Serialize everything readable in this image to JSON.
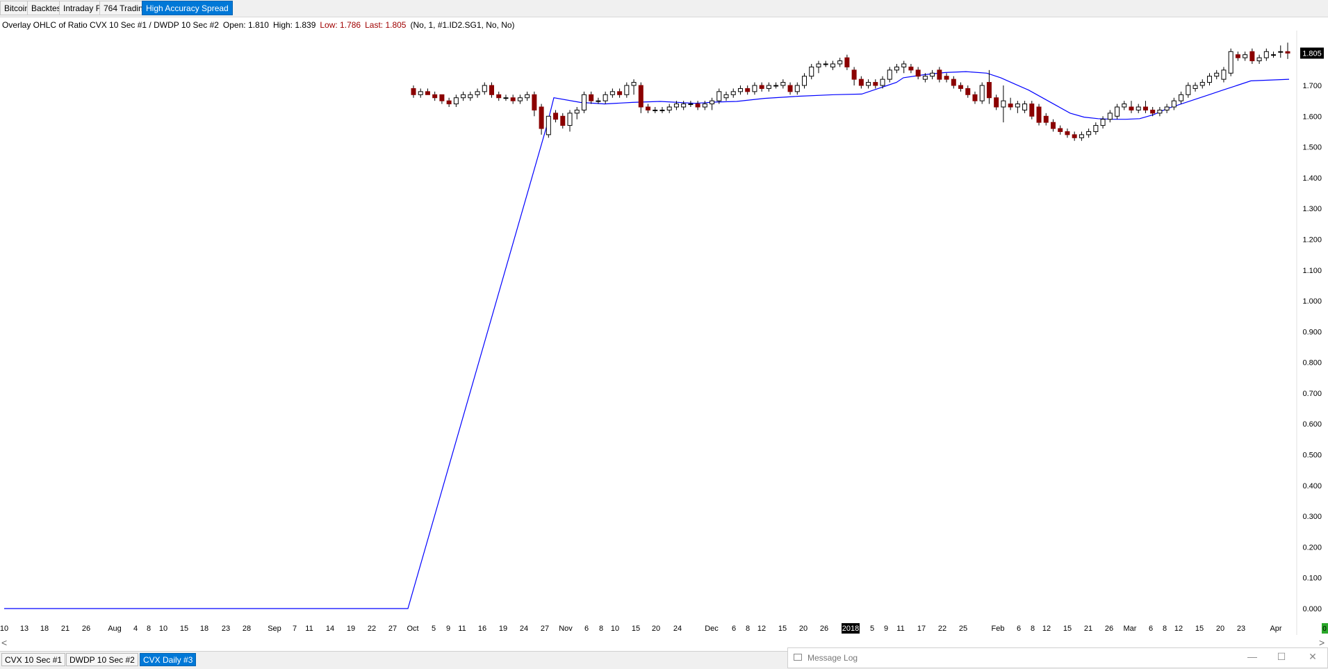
{
  "tabs": [
    "Bitcoin",
    "Backtest",
    "Intraday FX",
    "764 Trading",
    "High Accuracy Spread"
  ],
  "info": {
    "prefix": "Overlay OHLC of Ratio CVX  10 Sec  #1 / DWDP  10 Sec  #2",
    "open": "Open: 1.810",
    "high": "High: 1.839",
    "low": "Low: 1.786",
    "last": "Last: 1.805",
    "params": "(No, 1, #1.ID2.SG1, No, No)"
  },
  "chart_data": {
    "type": "candlestick",
    "y_ticks": [
      "1.805",
      "1.700",
      "1.600",
      "1.500",
      "1.400",
      "1.300",
      "1.200",
      "1.100",
      "1.000",
      "0.900",
      "0.800",
      "0.700",
      "0.600",
      "0.500",
      "0.400",
      "0.300",
      "0.200",
      "0.100",
      "0.000"
    ],
    "current_value": "1.805",
    "x_ticks": [
      "10",
      "13",
      "18",
      "21",
      "26",
      "Aug",
      "4",
      "8",
      "10",
      "15",
      "18",
      "23",
      "28",
      "Sep",
      "7",
      "11",
      "14",
      "19",
      "22",
      "27",
      "Oct",
      "5",
      "9",
      "11",
      "16",
      "19",
      "24",
      "27",
      "Nov",
      "6",
      "8",
      "10",
      "15",
      "20",
      "24",
      "Dec",
      "6",
      "8",
      "12",
      "15",
      "20",
      "26",
      "2018",
      "5",
      "9",
      "11",
      "17",
      "22",
      "25",
      "Feb",
      "6",
      "8",
      "12",
      "15",
      "21",
      "26",
      "Mar",
      "6",
      "8",
      "12",
      "15",
      "20",
      "23",
      "Apr"
    ],
    "ylim": [
      0,
      1.82
    ],
    "candles": [
      [
        1.69,
        1.7,
        1.66,
        1.67
      ],
      [
        1.67,
        1.69,
        1.66,
        1.68
      ],
      [
        1.68,
        1.69,
        1.67,
        1.67
      ],
      [
        1.67,
        1.68,
        1.65,
        1.66
      ],
      [
        1.67,
        1.67,
        1.64,
        1.65
      ],
      [
        1.65,
        1.66,
        1.63,
        1.64
      ],
      [
        1.64,
        1.67,
        1.63,
        1.66
      ],
      [
        1.66,
        1.68,
        1.65,
        1.67
      ],
      [
        1.66,
        1.68,
        1.65,
        1.67
      ],
      [
        1.67,
        1.69,
        1.66,
        1.68
      ],
      [
        1.68,
        1.71,
        1.67,
        1.7
      ],
      [
        1.7,
        1.71,
        1.66,
        1.67
      ],
      [
        1.67,
        1.68,
        1.65,
        1.66
      ],
      [
        1.66,
        1.67,
        1.65,
        1.66
      ],
      [
        1.66,
        1.67,
        1.64,
        1.65
      ],
      [
        1.65,
        1.67,
        1.64,
        1.66
      ],
      [
        1.66,
        1.68,
        1.65,
        1.67
      ],
      [
        1.67,
        1.68,
        1.6,
        1.62
      ],
      [
        1.63,
        1.64,
        1.54,
        1.56
      ],
      [
        1.54,
        1.6,
        1.53,
        1.6
      ],
      [
        1.61,
        1.62,
        1.58,
        1.59
      ],
      [
        1.6,
        1.61,
        1.56,
        1.57
      ],
      [
        1.57,
        1.62,
        1.55,
        1.61
      ],
      [
        1.61,
        1.63,
        1.59,
        1.62
      ],
      [
        1.62,
        1.68,
        1.61,
        1.67
      ],
      [
        1.67,
        1.68,
        1.64,
        1.65
      ],
      [
        1.65,
        1.66,
        1.64,
        1.65
      ],
      [
        1.65,
        1.68,
        1.64,
        1.67
      ],
      [
        1.67,
        1.69,
        1.66,
        1.68
      ],
      [
        1.68,
        1.69,
        1.66,
        1.67
      ],
      [
        1.67,
        1.71,
        1.66,
        1.7
      ],
      [
        1.7,
        1.72,
        1.67,
        1.71
      ],
      [
        1.7,
        1.71,
        1.61,
        1.63
      ],
      [
        1.63,
        1.64,
        1.61,
        1.62
      ],
      [
        1.62,
        1.63,
        1.61,
        1.62
      ],
      [
        1.62,
        1.63,
        1.61,
        1.62
      ],
      [
        1.62,
        1.64,
        1.61,
        1.63
      ],
      [
        1.63,
        1.65,
        1.62,
        1.64
      ],
      [
        1.63,
        1.65,
        1.62,
        1.64
      ],
      [
        1.64,
        1.65,
        1.63,
        1.64
      ],
      [
        1.64,
        1.65,
        1.62,
        1.63
      ],
      [
        1.63,
        1.65,
        1.62,
        1.64
      ],
      [
        1.64,
        1.66,
        1.62,
        1.65
      ],
      [
        1.65,
        1.69,
        1.64,
        1.68
      ],
      [
        1.66,
        1.68,
        1.65,
        1.67
      ],
      [
        1.67,
        1.69,
        1.66,
        1.68
      ],
      [
        1.68,
        1.7,
        1.67,
        1.69
      ],
      [
        1.69,
        1.7,
        1.67,
        1.68
      ],
      [
        1.68,
        1.71,
        1.67,
        1.7
      ],
      [
        1.7,
        1.71,
        1.68,
        1.69
      ],
      [
        1.69,
        1.71,
        1.68,
        1.7
      ],
      [
        1.7,
        1.71,
        1.69,
        1.7
      ],
      [
        1.7,
        1.72,
        1.69,
        1.71
      ],
      [
        1.7,
        1.71,
        1.67,
        1.68
      ],
      [
        1.68,
        1.71,
        1.67,
        1.7
      ],
      [
        1.7,
        1.74,
        1.69,
        1.73
      ],
      [
        1.73,
        1.77,
        1.72,
        1.76
      ],
      [
        1.76,
        1.78,
        1.74,
        1.77
      ],
      [
        1.77,
        1.78,
        1.76,
        1.77
      ],
      [
        1.76,
        1.78,
        1.75,
        1.77
      ],
      [
        1.77,
        1.79,
        1.76,
        1.78
      ],
      [
        1.79,
        1.8,
        1.75,
        1.76
      ],
      [
        1.75,
        1.76,
        1.7,
        1.72
      ],
      [
        1.72,
        1.73,
        1.69,
        1.7
      ],
      [
        1.7,
        1.72,
        1.69,
        1.71
      ],
      [
        1.71,
        1.72,
        1.69,
        1.7
      ],
      [
        1.7,
        1.73,
        1.69,
        1.72
      ],
      [
        1.72,
        1.76,
        1.71,
        1.75
      ],
      [
        1.75,
        1.77,
        1.74,
        1.76
      ],
      [
        1.76,
        1.78,
        1.74,
        1.77
      ],
      [
        1.76,
        1.77,
        1.74,
        1.75
      ],
      [
        1.75,
        1.76,
        1.72,
        1.73
      ],
      [
        1.72,
        1.74,
        1.71,
        1.73
      ],
      [
        1.73,
        1.75,
        1.72,
        1.74
      ],
      [
        1.75,
        1.76,
        1.71,
        1.72
      ],
      [
        1.73,
        1.74,
        1.71,
        1.72
      ],
      [
        1.72,
        1.73,
        1.69,
        1.7
      ],
      [
        1.7,
        1.71,
        1.68,
        1.69
      ],
      [
        1.69,
        1.7,
        1.66,
        1.67
      ],
      [
        1.67,
        1.68,
        1.64,
        1.65
      ],
      [
        1.65,
        1.71,
        1.64,
        1.7
      ],
      [
        1.71,
        1.75,
        1.64,
        1.66
      ],
      [
        1.66,
        1.67,
        1.62,
        1.63
      ],
      [
        1.63,
        1.7,
        1.58,
        1.65
      ],
      [
        1.64,
        1.66,
        1.62,
        1.63
      ],
      [
        1.63,
        1.65,
        1.61,
        1.64
      ],
      [
        1.62,
        1.65,
        1.61,
        1.64
      ],
      [
        1.64,
        1.65,
        1.59,
        1.6
      ],
      [
        1.63,
        1.64,
        1.57,
        1.58
      ],
      [
        1.6,
        1.61,
        1.57,
        1.58
      ],
      [
        1.58,
        1.59,
        1.55,
        1.56
      ],
      [
        1.56,
        1.57,
        1.54,
        1.55
      ],
      [
        1.55,
        1.56,
        1.53,
        1.54
      ],
      [
        1.54,
        1.55,
        1.52,
        1.53
      ],
      [
        1.53,
        1.55,
        1.52,
        1.54
      ],
      [
        1.54,
        1.56,
        1.53,
        1.55
      ],
      [
        1.55,
        1.58,
        1.54,
        1.57
      ],
      [
        1.57,
        1.6,
        1.56,
        1.59
      ],
      [
        1.59,
        1.62,
        1.58,
        1.61
      ],
      [
        1.6,
        1.64,
        1.59,
        1.63
      ],
      [
        1.63,
        1.65,
        1.62,
        1.64
      ],
      [
        1.63,
        1.65,
        1.61,
        1.62
      ],
      [
        1.62,
        1.64,
        1.61,
        1.63
      ],
      [
        1.63,
        1.65,
        1.61,
        1.62
      ],
      [
        1.62,
        1.63,
        1.6,
        1.61
      ],
      [
        1.61,
        1.63,
        1.6,
        1.62
      ],
      [
        1.62,
        1.64,
        1.61,
        1.63
      ],
      [
        1.63,
        1.66,
        1.62,
        1.65
      ],
      [
        1.65,
        1.68,
        1.64,
        1.67
      ],
      [
        1.67,
        1.71,
        1.66,
        1.7
      ],
      [
        1.69,
        1.71,
        1.68,
        1.7
      ],
      [
        1.7,
        1.72,
        1.69,
        1.71
      ],
      [
        1.71,
        1.74,
        1.7,
        1.73
      ],
      [
        1.73,
        1.75,
        1.72,
        1.74
      ],
      [
        1.72,
        1.76,
        1.71,
        1.75
      ],
      [
        1.74,
        1.82,
        1.73,
        1.81
      ],
      [
        1.8,
        1.81,
        1.78,
        1.79
      ],
      [
        1.79,
        1.81,
        1.78,
        1.8
      ],
      [
        1.81,
        1.82,
        1.77,
        1.78
      ],
      [
        1.78,
        1.8,
        1.77,
        1.79
      ],
      [
        1.79,
        1.82,
        1.78,
        1.81
      ],
      [
        1.8,
        1.81,
        1.79,
        1.8
      ],
      [
        1.81,
        1.83,
        1.79,
        1.81
      ],
      [
        1.81,
        1.839,
        1.786,
        1.805
      ]
    ],
    "ma_line": [
      [
        0,
        0
      ],
      [
        1,
        0
      ],
      [
        2,
        0
      ],
      [
        3,
        0
      ],
      [
        4,
        0
      ],
      [
        5,
        0
      ],
      [
        6,
        0
      ],
      [
        7,
        0
      ],
      [
        8,
        0
      ],
      [
        9,
        0
      ],
      [
        10,
        0
      ],
      [
        11,
        0
      ],
      [
        12,
        0
      ],
      [
        13,
        0
      ],
      [
        14,
        0
      ],
      [
        15,
        0
      ],
      [
        16,
        0
      ],
      [
        17,
        0
      ],
      [
        18,
        0
      ],
      [
        19,
        0
      ],
      [
        20,
        0
      ],
      [
        21,
        0
      ],
      [
        22,
        0
      ],
      [
        23,
        0
      ],
      [
        24,
        0
      ],
      [
        25,
        0
      ],
      [
        26,
        0
      ],
      [
        27,
        0
      ],
      [
        28,
        0
      ],
      [
        29,
        0
      ],
      [
        30,
        0
      ],
      [
        31,
        0
      ],
      [
        32,
        0
      ],
      [
        33,
        0
      ],
      [
        34,
        0
      ],
      [
        35,
        0
      ],
      [
        36,
        0
      ],
      [
        37,
        0
      ],
      [
        38,
        0
      ],
      [
        39,
        0
      ],
      [
        40,
        0
      ],
      [
        41,
        0
      ],
      [
        42,
        0
      ],
      [
        43,
        0
      ],
      [
        44,
        0
      ],
      [
        45,
        0
      ],
      [
        46,
        0
      ],
      [
        47,
        0
      ],
      [
        48,
        0
      ],
      [
        49,
        0
      ],
      [
        50,
        0
      ],
      [
        51,
        0
      ],
      [
        52,
        0
      ],
      [
        53,
        0
      ],
      [
        54,
        0
      ],
      [
        55,
        0
      ],
      [
        56,
        0
      ],
      [
        57,
        0
      ],
      [
        58,
        0
      ],
      [
        59,
        0
      ],
      [
        60,
        0
      ],
      [
        61,
        0
      ],
      [
        62,
        0
      ],
      [
        63,
        0
      ],
      [
        64,
        0
      ],
      [
        65,
        0
      ],
      [
        66,
        0
      ],
      [
        67,
        0
      ],
      [
        68,
        0
      ],
      [
        69,
        0
      ],
      [
        70,
        0
      ],
      [
        71,
        0
      ],
      [
        72,
        0
      ],
      [
        73,
        0
      ],
      [
        74,
        0
      ],
      [
        75,
        0
      ],
      [
        76,
        0
      ],
      [
        77,
        0
      ],
      [
        78,
        0
      ]
    ],
    "ma_series": [
      0.0,
      0.0,
      1.57,
      1.66,
      1.65,
      1.64,
      1.645,
      1.65,
      1.648,
      1.64,
      1.643,
      1.645,
      1.645,
      1.653,
      1.66,
      1.665,
      1.667,
      1.67,
      1.672,
      1.69,
      1.71,
      1.72,
      1.724,
      1.73,
      1.735,
      1.74,
      1.745,
      1.745,
      1.738,
      1.73,
      1.72,
      1.7,
      1.68,
      1.66,
      1.64,
      1.62,
      1.6,
      1.592,
      1.59,
      1.59,
      1.6,
      1.62,
      1.64,
      1.665,
      1.69,
      1.72
    ]
  },
  "bottom_tabs": [
    "CVX  10 Sec  #1",
    "DWDP  10 Sec  #2",
    "CVX  Daily  #3"
  ],
  "message_log": {
    "title": "Message Log",
    "minimize": "—",
    "maximize": "☐",
    "close": "✕"
  },
  "scroll": {
    "left": "<",
    "right": ">"
  },
  "status_indicator": "0"
}
